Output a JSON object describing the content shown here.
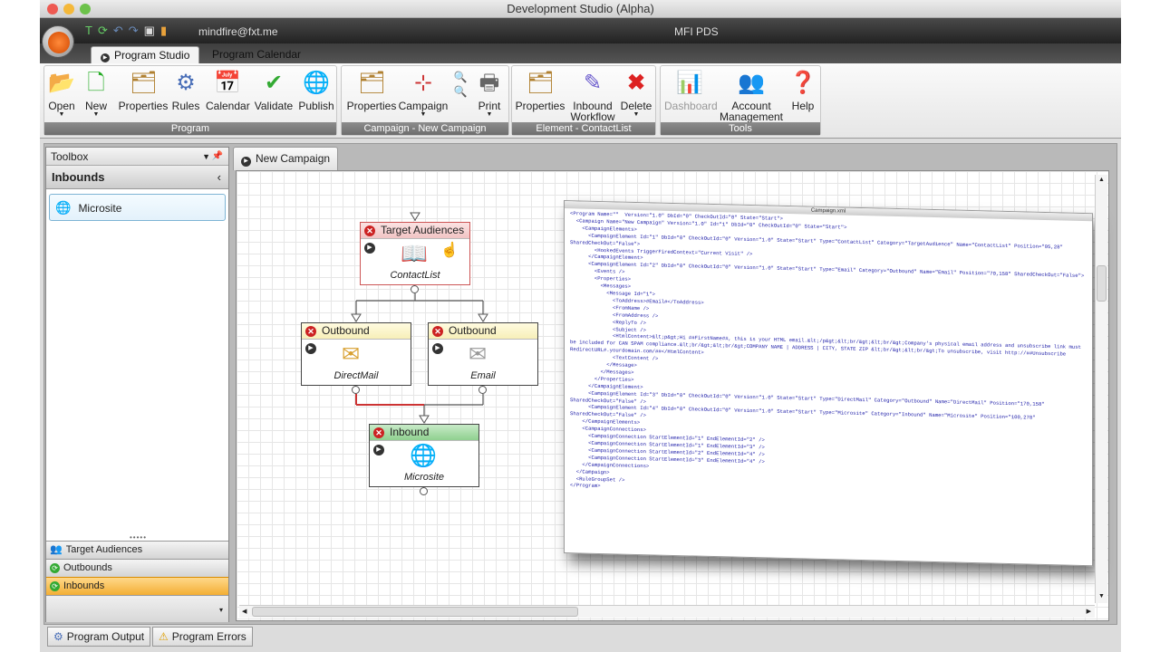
{
  "window": {
    "title": "Development Studio (Alpha)"
  },
  "toolbar": {
    "user": "mindfire@fxt.me",
    "product": "MFI PDS"
  },
  "ribbon": {
    "tabs": [
      {
        "label": "Program Studio"
      },
      {
        "label": "Program Calendar"
      }
    ],
    "groups": [
      {
        "label": "Program",
        "buttons": [
          "Open",
          "New",
          "Properties",
          "Rules",
          "Calendar",
          "Validate",
          "Publish"
        ]
      },
      {
        "label": "Campaign - New Campaign",
        "buttons": [
          "Properties",
          "Campaign",
          "Print"
        ]
      },
      {
        "label": "Element - ContactList",
        "buttons": [
          "Properties",
          "Inbound",
          "Workflow",
          "Delete"
        ]
      },
      {
        "label": "Tools",
        "buttons": [
          "Dashboard",
          "Account",
          "Management",
          "Help"
        ]
      }
    ]
  },
  "toolbox": {
    "title": "Toolbox",
    "section": "Inbounds",
    "items": [
      "Microsite"
    ],
    "accordion": [
      "Target Audiences",
      "Outbounds",
      "Inbounds"
    ]
  },
  "document": {
    "tab": "New Campaign"
  },
  "nodes": {
    "target": {
      "title": "Target Audiences",
      "label": "ContactList"
    },
    "outbound1": {
      "title": "Outbound",
      "label": "DirectMail"
    },
    "outbound2": {
      "title": "Outbound",
      "label": "Email"
    },
    "inbound": {
      "title": "Inbound",
      "label": "Microsite"
    }
  },
  "xml_window": {
    "title": "Campaign.xml",
    "lines": [
      "<Program Name=\"\"  Version=\"1.0\" DbId=\"0\" CheckOutId=\"0\" State=\"Start\">",
      "  <Campaign Name=\"New Campaign\" Version=\"1.0\" Id=\"1\" DbId=\"0\" CheckOutId=\"0\" State=\"Start\">",
      "    <CampaignElements>",
      "      <CampaignElement Id=\"1\" DbId=\"0\" CheckOutId=\"0\" Version=\"1.0\" State=\"Start\" Type=\"ContactList\" Category=\"TargetAudience\" Name=\"ContactList\" Position=\"95,28\"",
      "SharedCheckOut=\"False\">",
      "        <HookedEvents TriggerFiredContext=\"Current Visit\" />",
      "      </CampaignElement>",
      "      <CampaignElement Id=\"2\" DbId=\"0\" CheckOutId=\"0\" Version=\"1.0\" State=\"Start\" Type=\"Email\" Category=\"Outbound\" Name=\"Email\" Position=\"70,158\" SharedCheckOut=\"False\">",
      "        <Events />",
      "        <Properties>",
      "          <Messages>",
      "            <Message Id=\"1\">",
      "              <ToAddress>#Email#</ToAddress>",
      "              <FromName />",
      "              <FromAddress />",
      "              <ReplyTo />",
      "              <Subject />",
      "              <HtmlContent>&lt;p&gt;Hi ##FirstName##, this is your HTML email.&lt;/p&gt;&lt;br/&gt;&lt;br/&gt;Company's physical email address and unsubscribe link must",
      "be included for CAN SPAM compliance.&lt;br/&gt;&lt;br/&gt;COMPANY NAME | ADDRESS | CITY, STATE ZIP &lt;br/&gt;&lt;br/&gt;To unsubscribe, visit http://##Unsubscribe",
      "RedirectURL#.yourdomain.com/##</HtmlContent>",
      "              <TextContent />",
      "            </Message>",
      "          </Messages>",
      "        </Properties>",
      "      </CampaignElement>",
      "      <CampaignElement Id=\"3\" DbId=\"0\" CheckOutId=\"0\" Version=\"1.0\" State=\"Start\" Type=\"DirectMail\" Category=\"Outbound\" Name=\"DirectMail\" Position=\"170,158\"",
      "SharedCheckOut=\"False\" />",
      "      <CampaignElement Id=\"4\" DbId=\"0\" CheckOutId=\"0\" Version=\"1.0\" State=\"Start\" Type=\"Microsite\" Category=\"Inbound\" Name=\"Microsite\" Position=\"100,278\"",
      "SharedCheckOut=\"False\" />",
      "    </CampaignElements>",
      "    <CampaignConnections>",
      "      <CampaignConnection StartElementId=\"1\" EndElementId=\"2\" />",
      "      <CampaignConnection StartElementId=\"1\" EndElementId=\"3\" />",
      "      <CampaignConnection StartElementId=\"2\" EndElementId=\"4\" />",
      "      <CampaignConnection StartElementId=\"3\" EndElementId=\"4\" />",
      "    </CampaignConnections>",
      "  </Campaign>",
      "  <RuleGroupSet />",
      "</Program>"
    ]
  },
  "bottom_tabs": [
    "Program Output",
    "Program Errors"
  ]
}
